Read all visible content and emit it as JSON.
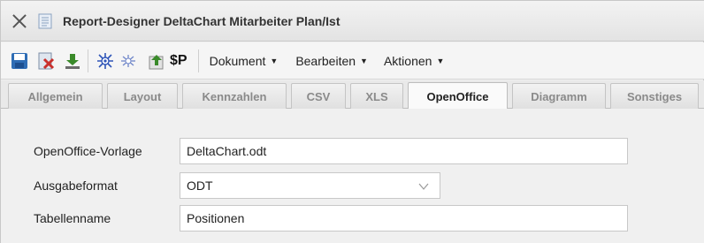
{
  "window": {
    "title": "Report-Designer DeltaChart Mitarbeiter Plan/Ist"
  },
  "toolbar": {
    "icons": [
      "save-icon",
      "delete-report-icon",
      "download-icon",
      "preview-icon",
      "preview-dim-icon",
      "upload-icon"
    ],
    "dollar_label": "$P",
    "menus": [
      {
        "label": "Dokument"
      },
      {
        "label": "Bearbeiten"
      },
      {
        "label": "Aktionen"
      }
    ]
  },
  "tabs": [
    {
      "label": "Allgemein"
    },
    {
      "label": "Layout"
    },
    {
      "label": "Kennzahlen"
    },
    {
      "label": "CSV"
    },
    {
      "label": "XLS"
    },
    {
      "label": "OpenOffice",
      "active": true
    },
    {
      "label": "Diagramm"
    },
    {
      "label": "Sonstiges"
    }
  ],
  "form": {
    "template": {
      "label": "OpenOffice-Vorlage",
      "value": "DeltaChart.odt"
    },
    "output_format": {
      "label": "Ausgabeformat",
      "value": "ODT"
    },
    "table_name": {
      "label": "Tabellenname",
      "value": "Positionen"
    }
  },
  "colors": {
    "accent_blue": "#2f6db5",
    "delete_red": "#c9302c",
    "download_green": "#3a8a2a"
  }
}
